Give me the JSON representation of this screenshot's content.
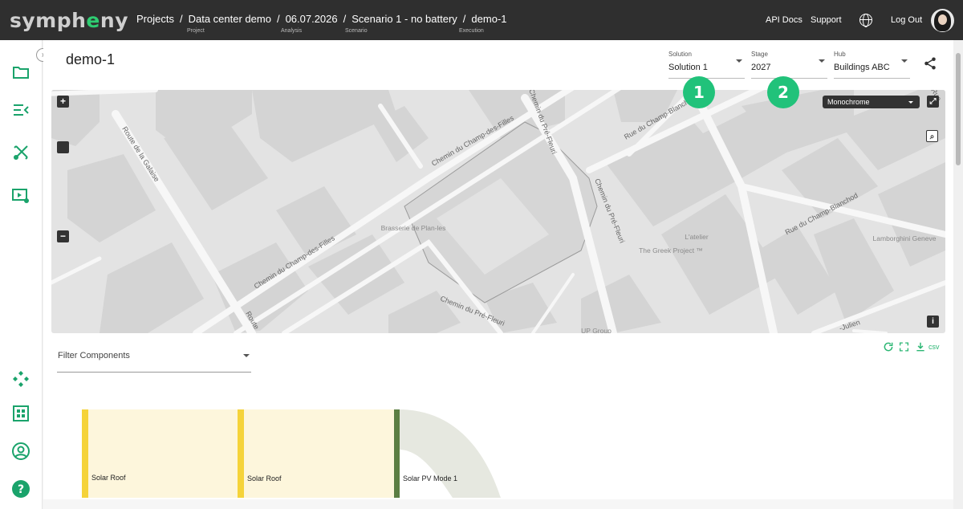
{
  "app": {
    "logo_pre": "symph",
    "logo_e": "e",
    "logo_post": "ny"
  },
  "breadcrumb": [
    {
      "label": "Projects",
      "sub": "Project"
    },
    {
      "label": "Data center demo",
      "sub": "Analysis"
    },
    {
      "label": "06.07.2026",
      "sub": "Scenario"
    },
    {
      "label": "Scenario 1 - no battery",
      "sub": "Execution"
    },
    {
      "label": "demo-1",
      "sub": ""
    }
  ],
  "breadcrumb_sep": "/",
  "header_links": {
    "api_docs": "API Docs",
    "support": "Support",
    "logout": "Log Out"
  },
  "page": {
    "title": "demo-1"
  },
  "selectors": {
    "solution": {
      "label": "Solution",
      "value": "Solution 1"
    },
    "stage": {
      "label": "Stage",
      "value": "2027"
    },
    "hub": {
      "label": "Hub",
      "value": "Buildings ABC"
    }
  },
  "badges": {
    "one": "1",
    "two": "2"
  },
  "map": {
    "style_select": "Monochrome",
    "zoom_in": "+",
    "zoom_out": "−",
    "info": "i",
    "street_labels": [
      "Route de la Galaise",
      "Chemin du Champ-des-Filles",
      "Chemin du Champ-des-Filles",
      "Chemin du Pré-Fleuri",
      "Chemin du Pré-Fleuri",
      "Chemin du Pré-Fleuri",
      "Rue du Champ-Blanchod",
      "Rue du Champ-Blanchod",
      "Route",
      "Rue",
      "-Julien"
    ],
    "poi_labels": [
      "Brasserie de Plan-les",
      "L'atelier",
      "The Greek Project ™",
      "Lamborghini Geneve",
      "UP Group"
    ]
  },
  "filter": {
    "placeholder": "Filter Components"
  },
  "table_tools": {
    "csv": "csv"
  },
  "sankey_nodes": [
    {
      "label": "Solar Roof",
      "color": "#f5d33a"
    },
    {
      "label": "Solar Roof",
      "color": "#f5d33a"
    },
    {
      "label": "Solar PV Mode 1",
      "color": "#5b7e43"
    }
  ],
  "colors": {
    "accent": "#21c27a",
    "topbar": "#2f2f2f",
    "sidebar_icon": "#1aa36b"
  }
}
